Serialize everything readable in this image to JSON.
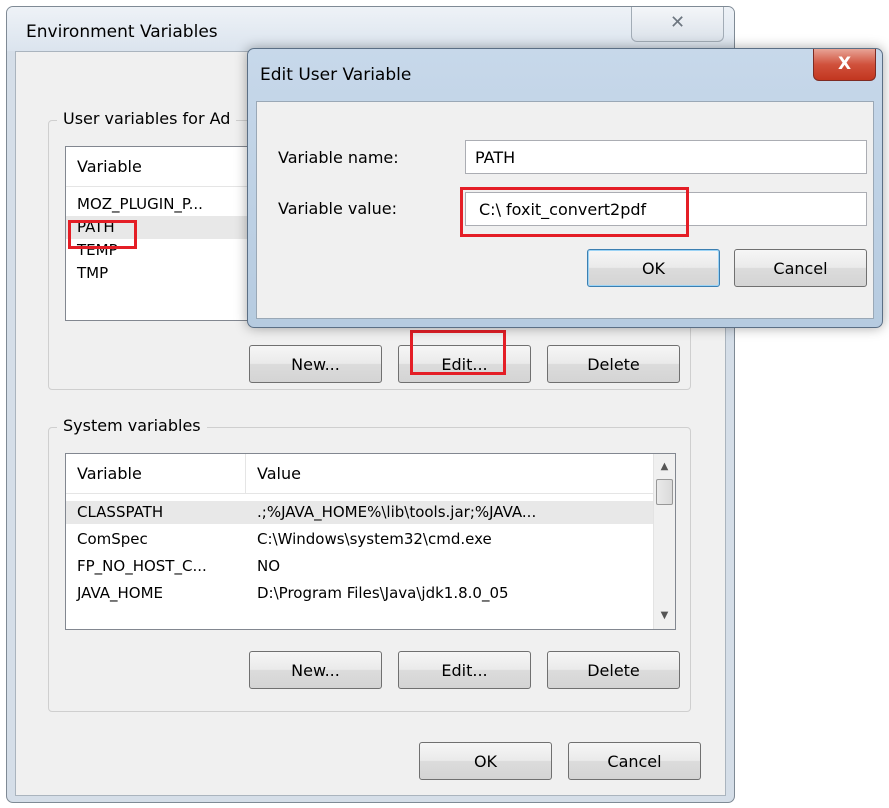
{
  "env_window": {
    "title": "Environment Variables",
    "close_glyph": "✕",
    "user_group_label": "User variables for Ad",
    "user_list": {
      "headers": [
        "Variable"
      ],
      "rows": [
        {
          "variable": "MOZ_PLUGIN_P..."
        },
        {
          "variable": "PATH"
        },
        {
          "variable": "TEMP"
        },
        {
          "variable": "TMP"
        }
      ],
      "selected_row": 1
    },
    "user_buttons": {
      "new": "New...",
      "edit": "Edit...",
      "delete": "Delete"
    },
    "system_group_label": "System variables",
    "system_list": {
      "headers": [
        "Variable",
        "Value"
      ],
      "rows": [
        {
          "variable": "CLASSPATH",
          "value": ".;%JAVA_HOME%\\lib\\tools.jar;%JAVA..."
        },
        {
          "variable": "ComSpec",
          "value": "C:\\Windows\\system32\\cmd.exe"
        },
        {
          "variable": "FP_NO_HOST_C...",
          "value": "NO"
        },
        {
          "variable": "JAVA_HOME",
          "value": "D:\\Program Files\\Java\\jdk1.8.0_05"
        }
      ],
      "selected_row": 0,
      "scroll_up_glyph": "▲",
      "scroll_down_glyph": "▼"
    },
    "system_buttons": {
      "new": "New...",
      "edit": "Edit...",
      "delete": "Delete"
    },
    "ok_label": "OK",
    "cancel_label": "Cancel"
  },
  "edit_dialog": {
    "title": "Edit User Variable",
    "close_glyph": "X",
    "name_label": "Variable name:",
    "name_value": "PATH",
    "value_label": "Variable value:",
    "value_value": "C:\\ foxit_convert2pdf",
    "ok_label": "OK",
    "cancel_label": "Cancel"
  },
  "colors": {
    "highlight": "#e41e26",
    "edit_titlebar": "#c7d8ea",
    "close_red": "#c2361f"
  },
  "icons": [
    "close-icon",
    "scroll-up-icon",
    "scroll-down-icon"
  ]
}
